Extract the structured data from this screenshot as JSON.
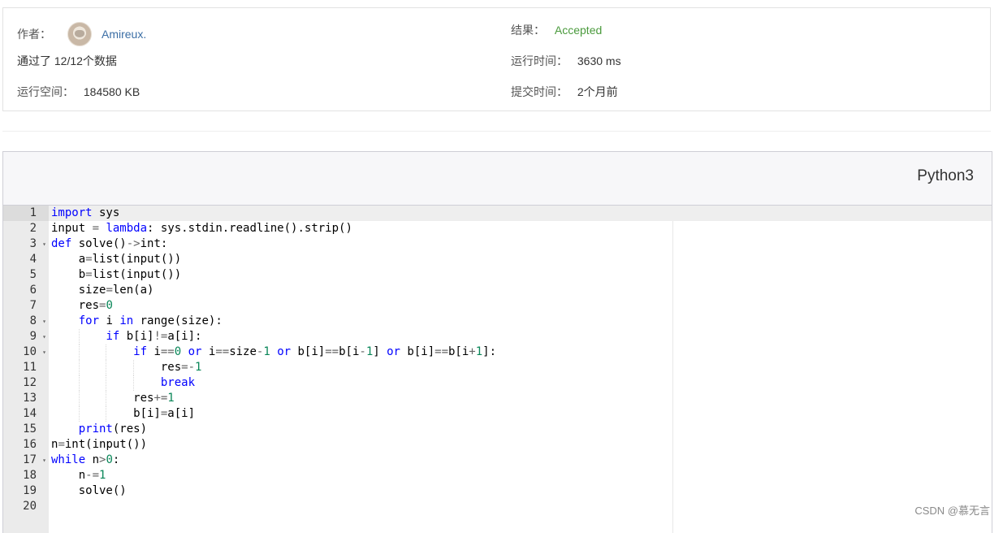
{
  "info": {
    "author_label": "作者：",
    "author_name": "Amireux.",
    "passed_text": "通过了 12/12个数据",
    "space_label": "运行空间：",
    "space_value": "184580 KB",
    "result_label": "结果：",
    "result_value": "Accepted",
    "time_label": "运行时间：",
    "time_value": "3630 ms",
    "submit_label": "提交时间：",
    "submit_value": "2个月前"
  },
  "code": {
    "language": "Python3",
    "active_line": 1,
    "lines": [
      {
        "n": "1",
        "indent": 0,
        "fold": false,
        "src": "import sys"
      },
      {
        "n": "2",
        "indent": 0,
        "fold": false,
        "src": "input = lambda: sys.stdin.readline().strip()"
      },
      {
        "n": "3",
        "indent": 0,
        "fold": true,
        "src": "def solve()->int:"
      },
      {
        "n": "4",
        "indent": 1,
        "fold": false,
        "src": "a=list(input())"
      },
      {
        "n": "5",
        "indent": 1,
        "fold": false,
        "src": "b=list(input())"
      },
      {
        "n": "6",
        "indent": 1,
        "fold": false,
        "src": "size=len(a)"
      },
      {
        "n": "7",
        "indent": 1,
        "fold": false,
        "src": "res=0"
      },
      {
        "n": "8",
        "indent": 1,
        "fold": true,
        "src": "for i in range(size):"
      },
      {
        "n": "9",
        "indent": 2,
        "fold": true,
        "src": "if b[i]!=a[i]:"
      },
      {
        "n": "10",
        "indent": 3,
        "fold": true,
        "src": "if i==0 or i==size-1 or b[i]==b[i-1] or b[i]==b[i+1]:"
      },
      {
        "n": "11",
        "indent": 4,
        "fold": false,
        "src": "res=-1"
      },
      {
        "n": "12",
        "indent": 4,
        "fold": false,
        "src": "break"
      },
      {
        "n": "13",
        "indent": 3,
        "fold": false,
        "src": "res+=1"
      },
      {
        "n": "14",
        "indent": 3,
        "fold": false,
        "src": "b[i]=a[i]"
      },
      {
        "n": "15",
        "indent": 1,
        "fold": false,
        "src": "print(res)"
      },
      {
        "n": "16",
        "indent": 0,
        "fold": false,
        "src": "n=int(input())"
      },
      {
        "n": "17",
        "indent": 0,
        "fold": true,
        "src": "while n>0:"
      },
      {
        "n": "18",
        "indent": 1,
        "fold": false,
        "src": "n-=1"
      },
      {
        "n": "19",
        "indent": 1,
        "fold": false,
        "src": "solve()"
      },
      {
        "n": "20",
        "indent": 0,
        "fold": false,
        "src": ""
      }
    ]
  },
  "watermark": "CSDN @慕无言",
  "colors": {
    "accepted": "#4a9a3c",
    "link": "#3b6ea5",
    "keyword": "#0000ff",
    "number": "#098658"
  }
}
